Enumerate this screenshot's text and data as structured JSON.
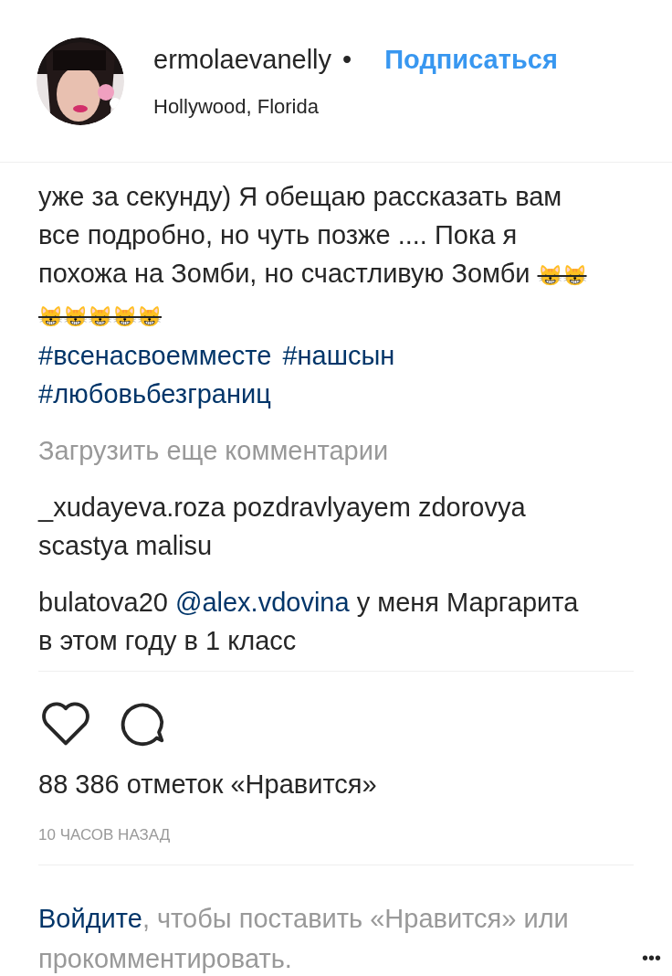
{
  "header": {
    "username": "ermolaevanelly",
    "separator": "•",
    "follow": "Подписаться",
    "location": "Hollywood, Florida"
  },
  "caption": {
    "text": "уже за секунду) Я обещаю рассказать вам все подробно, но чуть позже .... Пока я похожа на Зомби, но счастливую Зомби",
    "emoji": "😸😸😸😸😸😸😸",
    "hashtags": [
      "#всенасвоемместе",
      "#нашсын",
      "#любовьбезграниц"
    ]
  },
  "load_more": "Загрузить еще комментарии",
  "comments": [
    {
      "user": "_xudayeva.roza",
      "text": "pozdravlyayem zdorovya scastya malisu"
    },
    {
      "user": "bulatova20",
      "mention": "@alex.vdovina",
      "text": "у меня Маргарита в этом году в 1 класс"
    }
  ],
  "likes": "88 386 отметок «Нравится»",
  "time": "10 ЧАСОВ НАЗАД",
  "login": {
    "link": "Войдите",
    "text": ", чтобы поставить «Нравится» или прокомментировать."
  },
  "more": "•••"
}
